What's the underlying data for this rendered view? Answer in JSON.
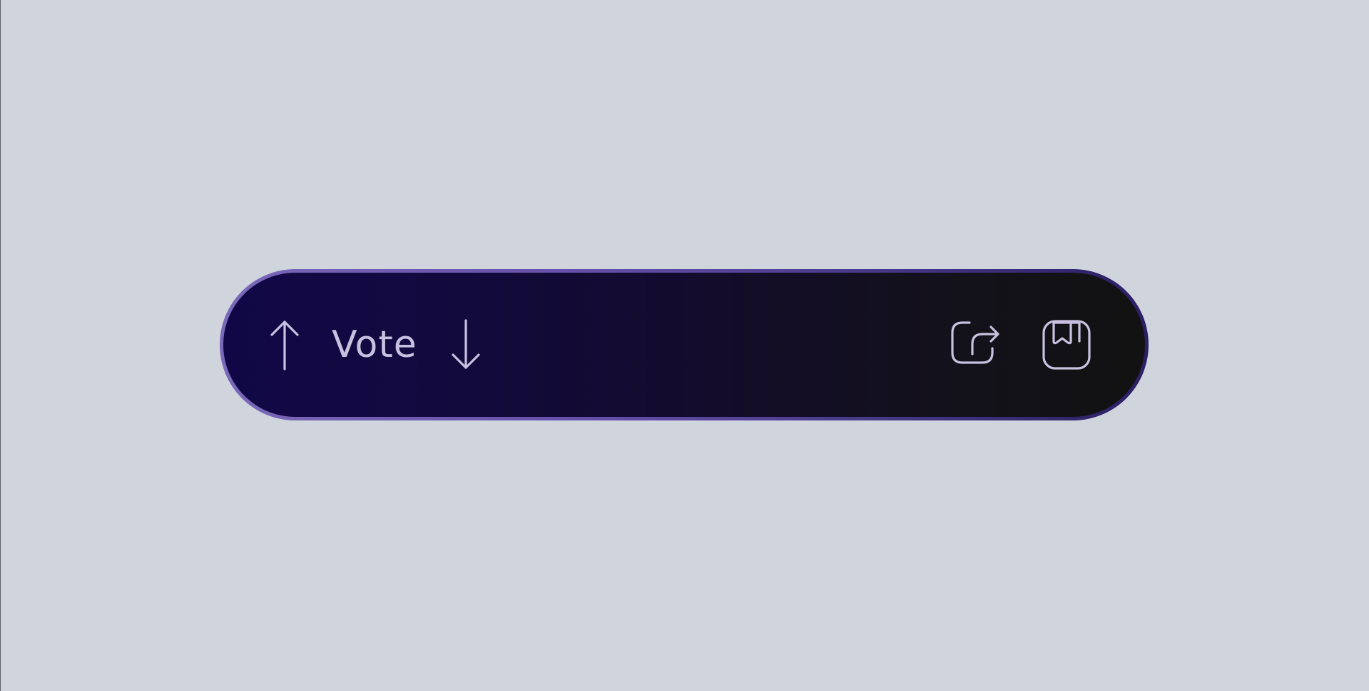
{
  "toolbar": {
    "vote_label": "Vote",
    "icons": {
      "upvote": "arrow-up-icon",
      "downvote": "arrow-down-icon",
      "share": "share-icon",
      "save": "bookmark-icon"
    }
  },
  "colors": {
    "page_background": "#d0d4dd",
    "toolbar_gradient_start": "#110747",
    "toolbar_gradient_end": "#121212",
    "border_start": "#7a68b8",
    "border_end": "#2c1f63",
    "foreground": "#c8c1e0"
  }
}
